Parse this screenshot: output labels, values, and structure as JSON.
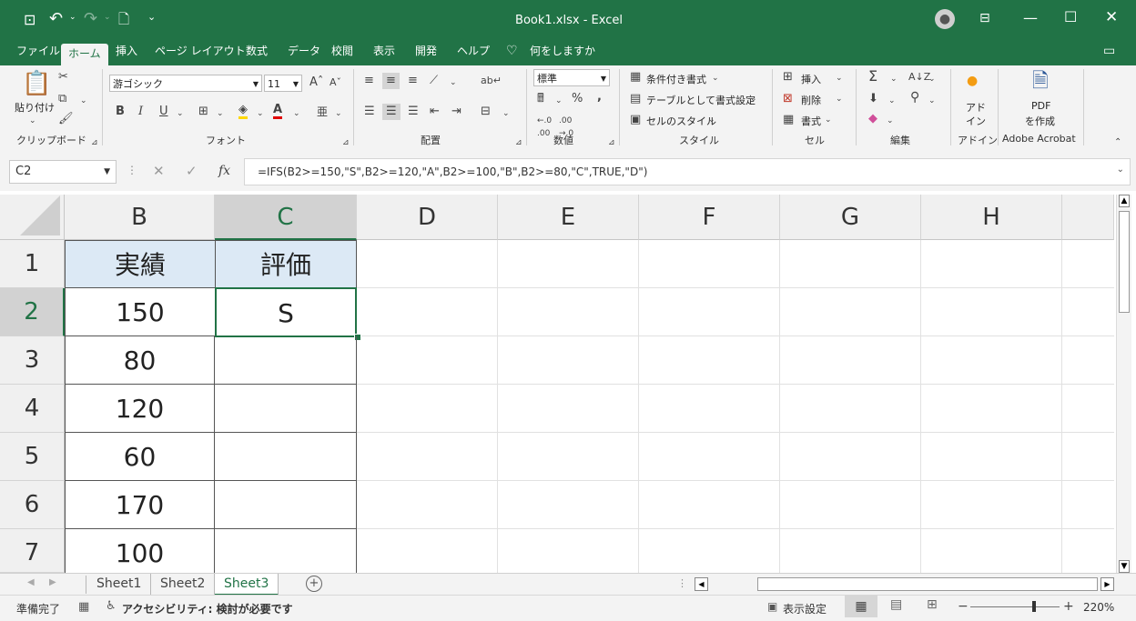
{
  "title_bar": {
    "title": "Book1.xlsx  -  Excel"
  },
  "ribbon_tabs": [
    "ファイル",
    "ホーム",
    "挿入",
    "ページ レイアウト",
    "数式",
    "データ",
    "校閲",
    "表示",
    "開発",
    "ヘルプ",
    "何をしますか"
  ],
  "ribbon": {
    "clipboard": {
      "paste": "貼り付け",
      "label": "クリップボード"
    },
    "font": {
      "name": "游ゴシック",
      "size": "11",
      "bold": "B",
      "italic": "I",
      "underline": "U",
      "label": "フォント"
    },
    "alignment": {
      "label": "配置"
    },
    "number": {
      "format": "標準",
      "percent": "%",
      "comma": ",",
      "label": "数値"
    },
    "styles": {
      "conditional": "条件付き書式",
      "table": "テーブルとして書式設定",
      "cell_styles": "セルのスタイル",
      "label": "スタイル"
    },
    "cells": {
      "insert": "挿入",
      "delete": "削除",
      "format": "書式",
      "label": "セル"
    },
    "editing": {
      "label": "編集"
    },
    "addins": {
      "line1": "アド",
      "line2": "イン",
      "label": "アドイン"
    },
    "acrobat": {
      "line1": "PDF",
      "line2": "を作成",
      "label": "Adobe Acrobat"
    }
  },
  "formula_bar": {
    "name_box": "C2",
    "fx": "fx",
    "formula": "=IFS(B2>=150,\"S\",B2>=120,\"A\",B2>=100,\"B\",B2>=80,\"C\",TRUE,\"D\")"
  },
  "grid": {
    "columns": [
      "B",
      "C",
      "D",
      "E",
      "F",
      "G",
      "H"
    ],
    "rows": [
      "1",
      "2",
      "3",
      "4",
      "5",
      "6",
      "7"
    ],
    "cells": {
      "B1": "実績",
      "C1": "評価",
      "B2": "150",
      "C2": "S",
      "B3": "80",
      "B4": "120",
      "B5": "60",
      "B6": "170",
      "B7": "100"
    },
    "active_cell": "C2",
    "header_fill": "#dce9f5"
  },
  "sheet_tabs": [
    "Sheet1",
    "Sheet2",
    "Sheet3"
  ],
  "active_sheet": "Sheet3",
  "status_bar": {
    "ready": "準備完了",
    "accessibility": "アクセシビリティ: 検討が必要です",
    "display_settings": "表示設定",
    "zoom": "220%"
  },
  "colors": {
    "accent": "#217346",
    "ribbon_bg": "#f3f3f3"
  }
}
